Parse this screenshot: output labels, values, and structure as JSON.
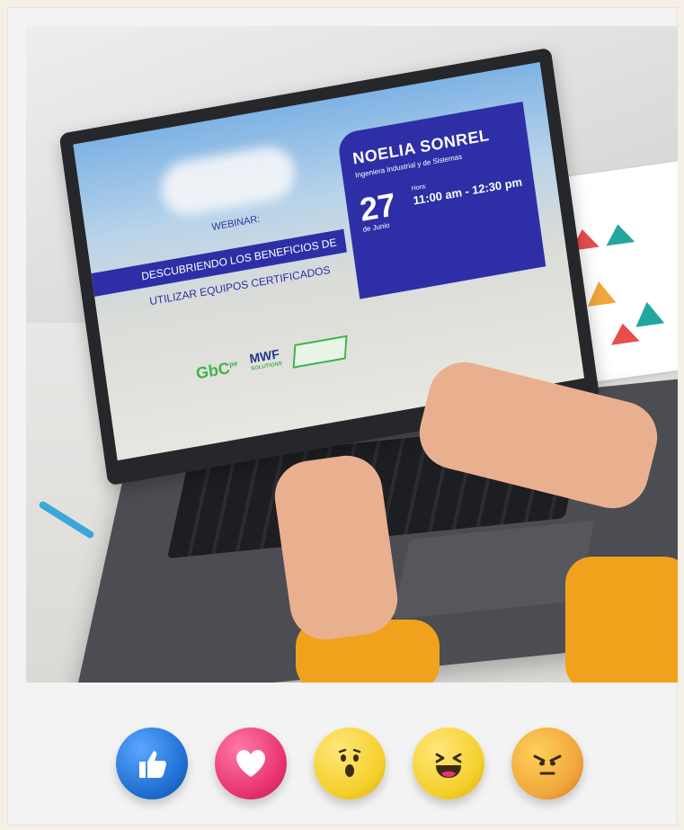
{
  "screen": {
    "webinar_label": "WEBINAR:",
    "title_line1": "DESCUBRIENDO LOS BENEFICIOS DE",
    "title_line2": "UTILIZAR EQUIPOS CERTIFICADOS",
    "speaker_name": "NOELIA SONREL",
    "speaker_role": "Ingeniera Industrial y de Sistemas",
    "date_day": "27",
    "date_month": "de Junio",
    "time_label": "Hora:",
    "time_value": "11:00 am - 12:30 pm"
  },
  "logos": {
    "gbc": "GbC",
    "gbc_suffix": "pe",
    "mwf": "MWF",
    "mwf_sub": "SOLUTIONS"
  },
  "reactions": [
    {
      "name": "like",
      "color": "#1f6fd1"
    },
    {
      "name": "love",
      "color": "#e8336f"
    },
    {
      "name": "wow",
      "color": "#f5cf2a"
    },
    {
      "name": "haha",
      "color": "#f5cf2a"
    },
    {
      "name": "angry",
      "color": "#f0a63a"
    }
  ],
  "colors": {
    "brand_blue": "#2e2fa6",
    "brand_green": "#3db54a"
  }
}
